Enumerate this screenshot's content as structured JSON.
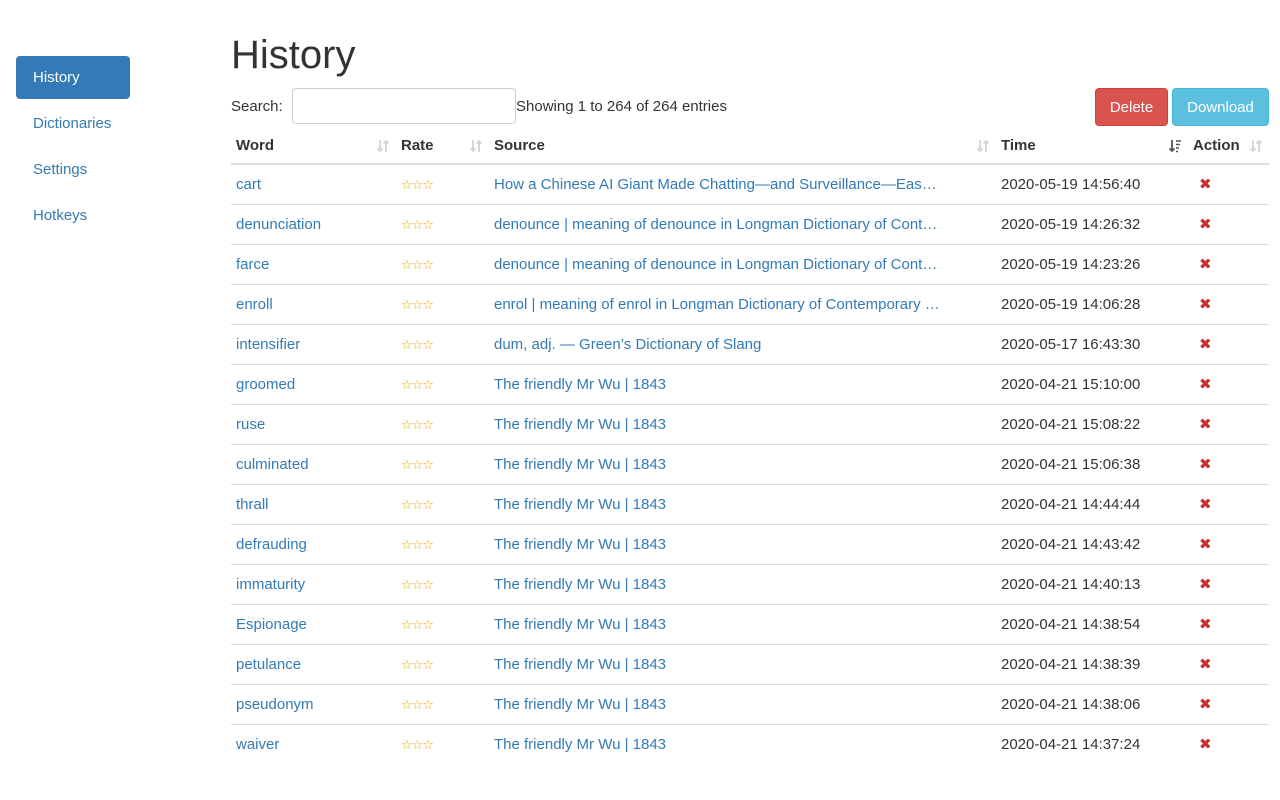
{
  "sidebar": {
    "items": [
      {
        "label": "History"
      },
      {
        "label": "Dictionaries"
      },
      {
        "label": "Settings"
      },
      {
        "label": "Hotkeys"
      }
    ]
  },
  "page": {
    "title": "History"
  },
  "search": {
    "label": "Search:",
    "value": "",
    "placeholder": ""
  },
  "info": "Showing 1 to 264 of 264 entries",
  "buttons": {
    "delete": "Delete",
    "download": "Download"
  },
  "table": {
    "headers": {
      "word": "Word",
      "rate": "Rate",
      "source": "Source",
      "time": "Time",
      "action": "Action"
    },
    "rows": [
      {
        "word": "cart",
        "rate": "☆☆☆",
        "source": "How a Chinese AI Giant Made Chatting—and Surveillance—Eas…",
        "time": "2020-05-19 14:56:40",
        "action": "✖"
      },
      {
        "word": "denunciation",
        "rate": "☆☆☆",
        "source": "denounce | meaning of denounce in Longman Dictionary of Cont…",
        "time": "2020-05-19 14:26:32",
        "action": "✖"
      },
      {
        "word": "farce",
        "rate": "☆☆☆",
        "source": "denounce | meaning of denounce in Longman Dictionary of Cont…",
        "time": "2020-05-19 14:23:26",
        "action": "✖"
      },
      {
        "word": "enroll",
        "rate": "☆☆☆",
        "source": "enrol | meaning of enrol in Longman Dictionary of Contemporary …",
        "time": "2020-05-19 14:06:28",
        "action": "✖"
      },
      {
        "word": "intensifier",
        "rate": "☆☆☆",
        "source": "dum, adj. — Green’s Dictionary of Slang",
        "time": "2020-05-17 16:43:30",
        "action": "✖"
      },
      {
        "word": "groomed",
        "rate": "☆☆☆",
        "source": "The friendly Mr Wu | 1843",
        "time": "2020-04-21 15:10:00",
        "action": "✖"
      },
      {
        "word": "ruse",
        "rate": "☆☆☆",
        "source": "The friendly Mr Wu | 1843",
        "time": "2020-04-21 15:08:22",
        "action": "✖"
      },
      {
        "word": "culminated",
        "rate": "☆☆☆",
        "source": "The friendly Mr Wu | 1843",
        "time": "2020-04-21 15:06:38",
        "action": "✖"
      },
      {
        "word": "thrall",
        "rate": "☆☆☆",
        "source": "The friendly Mr Wu | 1843",
        "time": "2020-04-21 14:44:44",
        "action": "✖"
      },
      {
        "word": "defrauding",
        "rate": "☆☆☆",
        "source": "The friendly Mr Wu | 1843",
        "time": "2020-04-21 14:43:42",
        "action": "✖"
      },
      {
        "word": "immaturity",
        "rate": "☆☆☆",
        "source": "The friendly Mr Wu | 1843",
        "time": "2020-04-21 14:40:13",
        "action": "✖"
      },
      {
        "word": "Espionage",
        "rate": "☆☆☆",
        "source": "The friendly Mr Wu | 1843",
        "time": "2020-04-21 14:38:54",
        "action": "✖"
      },
      {
        "word": "petulance",
        "rate": "☆☆☆",
        "source": "The friendly Mr Wu | 1843",
        "time": "2020-04-21 14:38:39",
        "action": "✖"
      },
      {
        "word": "pseudonym",
        "rate": "☆☆☆",
        "source": "The friendly Mr Wu | 1843",
        "time": "2020-04-21 14:38:06",
        "action": "✖"
      },
      {
        "word": "waiver",
        "rate": "☆☆☆",
        "source": "The friendly Mr Wu | 1843",
        "time": "2020-04-21 14:37:24",
        "action": "✖"
      }
    ]
  },
  "colors": {
    "primary": "#337ab7",
    "danger": "#d9534f",
    "info": "#5bc0de",
    "star": "#f0a30a",
    "delete_x": "#c9302c"
  }
}
